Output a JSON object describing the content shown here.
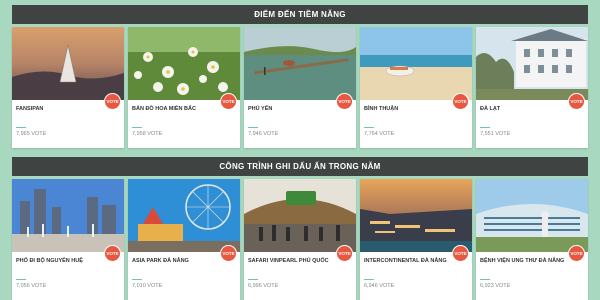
{
  "sections": [
    {
      "title": "Điểm đến tiềm năng",
      "cards": [
        {
          "name": "Fansipan",
          "votes": "7,965 VOTE",
          "vote_label": "VOTE"
        },
        {
          "name": "Bản đồ hoa miền Bắc",
          "votes": "7,958 VOTE",
          "vote_label": "VOTE"
        },
        {
          "name": "Phú Yên",
          "votes": "7,946 VOTE",
          "vote_label": "VOTE"
        },
        {
          "name": "Bình Thuận",
          "votes": "7,764 VOTE",
          "vote_label": "VOTE"
        },
        {
          "name": "Đà Lạt",
          "votes": "7,551 VOTE",
          "vote_label": "VOTE"
        }
      ]
    },
    {
      "title": "Công trình ghi dấu ấn trong năm",
      "cards": [
        {
          "name": "Phố đi bộ Nguyễn Huệ",
          "votes": "7,056 VOTE",
          "vote_label": "VOTE"
        },
        {
          "name": "Asia Park Đà Nẵng",
          "votes": "7,010 VOTE",
          "vote_label": "VOTE"
        },
        {
          "name": "Safari Vinpearl Phú Quốc",
          "votes": "6,996 VOTE",
          "vote_label": "VOTE"
        },
        {
          "name": "InterContinental Đà Nẵng",
          "votes": "6,946 VOTE",
          "vote_label": "VOTE"
        },
        {
          "name": "Bệnh viện ung thư Đà Nẵng",
          "votes": "6,923 VOTE",
          "vote_label": "VOTE"
        }
      ]
    }
  ],
  "colors": {
    "accent": "#e8573f",
    "bar": "#3f4443",
    "background": "#a8d8bf",
    "underline": "#6ec9a2"
  }
}
